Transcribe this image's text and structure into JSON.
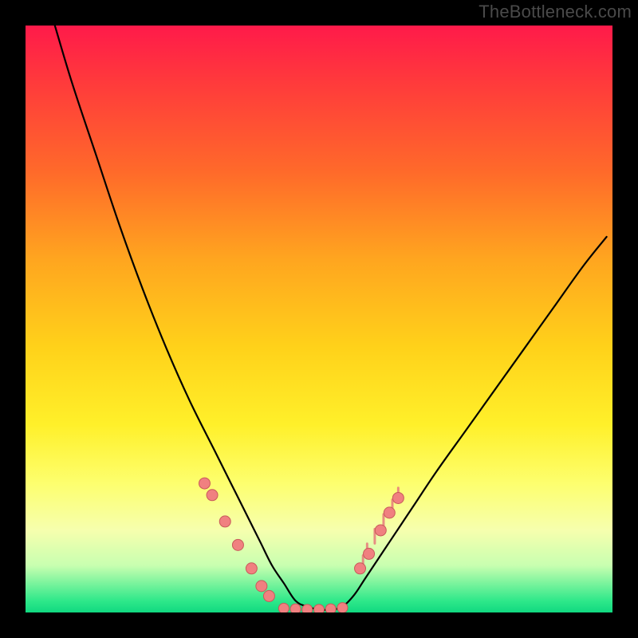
{
  "watermark": "TheBottleneck.com",
  "chart_data": {
    "type": "line",
    "title": "",
    "xlabel": "",
    "ylabel": "",
    "xlim": [
      0,
      100
    ],
    "ylim": [
      0,
      100
    ],
    "grid": false,
    "legend": false,
    "curve": {
      "x": [
        5,
        8,
        12,
        16,
        20,
        24,
        28,
        32,
        34,
        36,
        38,
        40,
        42,
        44,
        46,
        48,
        50,
        52,
        54,
        56,
        58,
        62,
        66,
        70,
        75,
        80,
        85,
        90,
        95,
        99
      ],
      "y": [
        100,
        90,
        78,
        66,
        55,
        45,
        36,
        28,
        24,
        20,
        16,
        12,
        8,
        5,
        2,
        1,
        0.5,
        0.5,
        1,
        3,
        6,
        12,
        18,
        24,
        31,
        38,
        45,
        52,
        59,
        64
      ]
    },
    "dots_left": {
      "x": [
        30.5,
        31.8,
        34.0,
        36.2,
        38.5,
        40.2,
        41.5
      ],
      "y": [
        22.0,
        20.0,
        15.5,
        11.5,
        7.5,
        4.5,
        2.8
      ]
    },
    "dots_bottom": {
      "x": [
        44.0,
        46.0,
        48.0,
        50.0,
        52.0,
        54.0
      ],
      "y": [
        0.7,
        0.6,
        0.5,
        0.5,
        0.6,
        0.8
      ]
    },
    "dots_right": {
      "x": [
        57.0,
        58.5,
        60.5,
        62.0,
        63.5
      ],
      "y": [
        7.5,
        10.0,
        14.0,
        17.0,
        19.5
      ]
    },
    "noise_right": {
      "x": [
        57.5,
        58.2,
        59.5,
        61.0,
        62.5,
        63.5
      ],
      "y": [
        8.5,
        10.5,
        13.0,
        15.5,
        18.0,
        20.0
      ]
    },
    "colors": {
      "curve": "#000000",
      "dot_fill": "#f08080",
      "dot_stroke": "#c85a5a",
      "noise": "#e77b7b"
    }
  }
}
